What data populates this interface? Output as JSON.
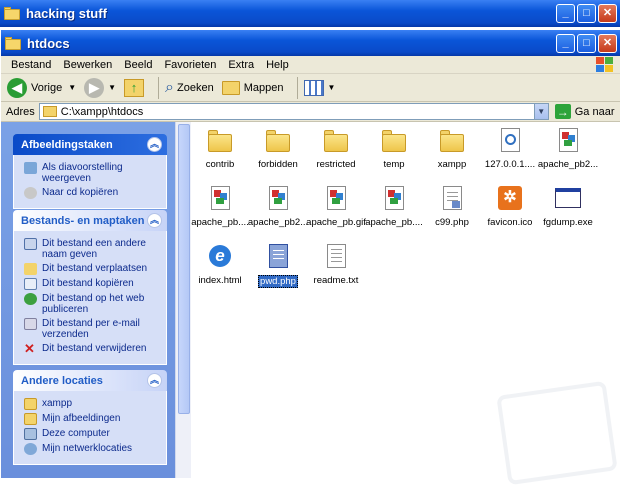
{
  "back_window": {
    "title": "hacking stuff"
  },
  "window": {
    "title": "htdocs",
    "buttons": [
      "_",
      "□",
      "✕"
    ]
  },
  "menu": [
    "Bestand",
    "Bewerken",
    "Beeld",
    "Favorieten",
    "Extra",
    "Help"
  ],
  "toolbar": {
    "back": "Vorige",
    "search": "Zoeken",
    "folders": "Mappen"
  },
  "address": {
    "label": "Adres",
    "value": "C:\\xampp\\htdocs",
    "go": "Ga naar"
  },
  "panels": {
    "image_tasks": {
      "title": "Afbeeldingstaken",
      "items": [
        "Als diavoorstelling weergeven",
        "Naar cd kopiëren"
      ]
    },
    "file_tasks": {
      "title": "Bestands- en maptaken",
      "items": [
        "Dit bestand een andere naam geven",
        "Dit bestand verplaatsen",
        "Dit bestand kopiëren",
        "Dit bestand op het web publiceren",
        "Dit bestand per e-mail verzenden",
        "Dit bestand verwijderen"
      ]
    },
    "other_places": {
      "title": "Andere locaties",
      "items": [
        "xampp",
        "Mijn afbeeldingen",
        "Deze computer",
        "Mijn netwerklocaties"
      ]
    }
  },
  "files": [
    {
      "name": "contrib",
      "type": "folder"
    },
    {
      "name": "forbidden",
      "type": "folder"
    },
    {
      "name": "restricted",
      "type": "folder"
    },
    {
      "name": "temp",
      "type": "folder"
    },
    {
      "name": "xampp",
      "type": "folder"
    },
    {
      "name": "127.0.0.1....",
      "type": "shortcut"
    },
    {
      "name": "apache_pb2...",
      "type": "image"
    },
    {
      "name": "apache_pb....",
      "type": "image"
    },
    {
      "name": "apache_pb2...",
      "type": "image"
    },
    {
      "name": "apache_pb.gif",
      "type": "image"
    },
    {
      "name": "apache_pb....",
      "type": "image"
    },
    {
      "name": "c99.php",
      "type": "php"
    },
    {
      "name": "favicon.ico",
      "type": "ico"
    },
    {
      "name": "fgdump.exe",
      "type": "exe"
    },
    {
      "name": "index.html",
      "type": "html"
    },
    {
      "name": "pwd.php",
      "type": "php",
      "selected": true
    },
    {
      "name": "readme.txt",
      "type": "txt"
    }
  ]
}
